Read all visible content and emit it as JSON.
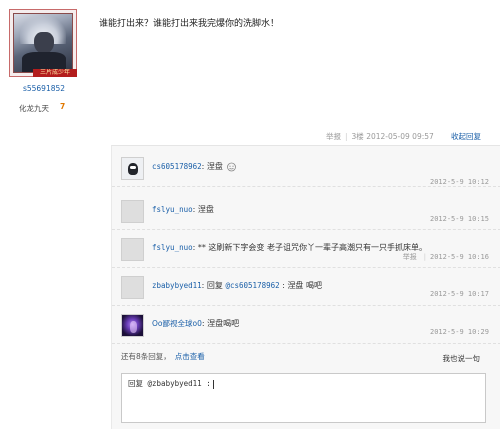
{
  "user": {
    "rank_badge": "三片成少年",
    "username": "s55691852",
    "level_title": "化龙九天",
    "level_num": "7"
  },
  "post": {
    "text": "谁能打出来？谁能打出来我完爆你的洗脚水！",
    "report": "举报",
    "floor": "3楼",
    "time": "2012-05-09 09:57",
    "collapse": "收起回复"
  },
  "comments": [
    {
      "user": "cs605178962",
      "sep": ":",
      "prefix": "",
      "mention": "",
      "text": "涅盘",
      "time": "2012-5-9 10:12",
      "report": "",
      "avatar_icon": "black-cat-avatar"
    },
    {
      "user": "fslyu_nuo",
      "sep": ":",
      "prefix": "",
      "mention": "",
      "text": "涅盘",
      "time": "2012-5-9 10:15",
      "report": "",
      "avatar_icon": "default-avatar"
    },
    {
      "user": "fslyu_nuo",
      "sep": ":",
      "prefix": "",
      "mention": "",
      "text": "** 这刷新下字会变 老子诅咒你丫一辈子高潮只有一只手抓床单。",
      "time": "2012-5-9 10:16",
      "report": "举报",
      "avatar_icon": "default-avatar"
    },
    {
      "user": "zbabybyed11",
      "sep": ":",
      "prefix": "回复 ",
      "mention": "@cs605178962",
      "text": " : 涅盘 喝吧",
      "time": "2012-5-9 10:17",
      "report": "",
      "avatar_icon": "default-avatar"
    },
    {
      "user": "Oo鄙视全球o0",
      "sep": ":",
      "prefix": "",
      "mention": "",
      "text": "涅盘喝吧",
      "time": "2012-5-9 10:29",
      "report": "",
      "avatar_icon": "purple-avatar"
    }
  ],
  "more": {
    "text": "还有8条回复，",
    "link": "点击查看"
  },
  "say": "我也说一句",
  "reply_box": {
    "label": "回复",
    "value": "@zbabybyed11 :"
  },
  "colors": {
    "link": "#1a5fa8",
    "badge": "#b31d1d",
    "meta": "#999999"
  }
}
